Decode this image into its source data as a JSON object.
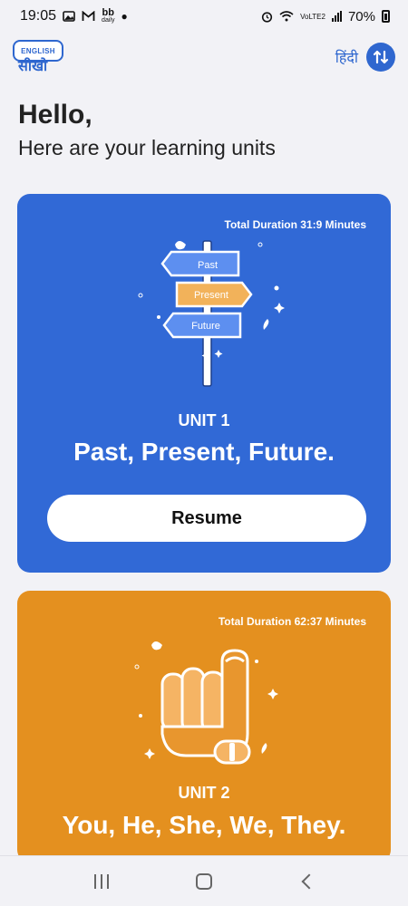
{
  "status_bar": {
    "time": "19:05",
    "notif_news_label": "daily",
    "network_label": "VoLTE2",
    "battery": "70%"
  },
  "header": {
    "logo_top": "ENGLISH",
    "logo_bottom": "सीखो",
    "language": "हिंदी"
  },
  "greeting": {
    "title": "Hello,",
    "subtitle": "Here are your learning units"
  },
  "units": [
    {
      "duration": "Total Duration 31:9 Minutes",
      "label": "UNIT 1",
      "title": "Past, Present, Future.",
      "signs": [
        "Past",
        "Present",
        "Future"
      ],
      "button": "Resume",
      "color": "#3169d6"
    },
    {
      "duration": "Total Duration 62:37 Minutes",
      "label": "UNIT 2",
      "title": "You, He, She, We, They.",
      "color": "#e4901f"
    }
  ],
  "colors": {
    "primary": "#2f67cf",
    "background": "#f2f2f6"
  }
}
